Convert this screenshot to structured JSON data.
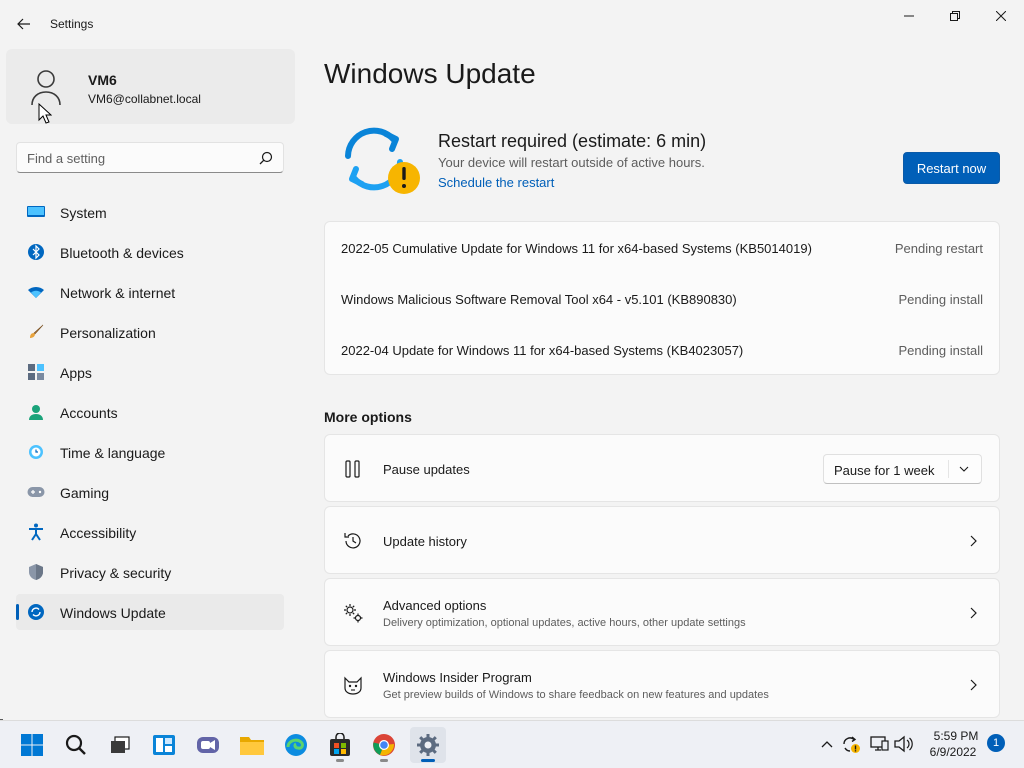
{
  "window": {
    "title": "Settings"
  },
  "profile": {
    "name": "VM6",
    "email": "VM6@collabnet.local"
  },
  "search": {
    "placeholder": "Find a setting"
  },
  "sidebar": {
    "items": [
      {
        "label": "System",
        "icon": "monitor-icon",
        "active": false
      },
      {
        "label": "Bluetooth & devices",
        "icon": "bluetooth-icon",
        "active": false
      },
      {
        "label": "Network & internet",
        "icon": "wifi-icon",
        "active": false
      },
      {
        "label": "Personalization",
        "icon": "brush-icon",
        "active": false
      },
      {
        "label": "Apps",
        "icon": "apps-icon",
        "active": false
      },
      {
        "label": "Accounts",
        "icon": "person-icon",
        "active": false
      },
      {
        "label": "Time & language",
        "icon": "globe-clock-icon",
        "active": false
      },
      {
        "label": "Gaming",
        "icon": "gamepad-icon",
        "active": false
      },
      {
        "label": "Accessibility",
        "icon": "accessibility-icon",
        "active": false
      },
      {
        "label": "Privacy & security",
        "icon": "shield-icon",
        "active": false
      },
      {
        "label": "Windows Update",
        "icon": "update-icon",
        "active": true
      }
    ]
  },
  "main": {
    "title": "Windows Update",
    "status": {
      "title": "Restart required (estimate: 6 min)",
      "subtitle": "Your device will restart outside of active hours.",
      "link": "Schedule the restart",
      "button": "Restart now"
    },
    "updates": [
      {
        "name": "2022-05 Cumulative Update for Windows 11 for x64-based Systems (KB5014019)",
        "status": "Pending restart"
      },
      {
        "name": "Windows Malicious Software Removal Tool x64 - v5.101 (KB890830)",
        "status": "Pending install"
      },
      {
        "name": "2022-04 Update for Windows 11 for x64-based Systems (KB4023057)",
        "status": "Pending install"
      }
    ],
    "more_options": {
      "heading": "More options",
      "pause": {
        "title": "Pause updates",
        "selected": "Pause for 1 week"
      },
      "history": {
        "title": "Update history"
      },
      "advanced": {
        "title": "Advanced options",
        "desc": "Delivery optimization, optional updates, active hours, other update settings"
      },
      "insider": {
        "title": "Windows Insider Program",
        "desc": "Get preview builds of Windows to share feedback on new features and updates"
      }
    }
  },
  "taskbar": {
    "apps": [
      "start-icon",
      "search-icon",
      "task-view-icon",
      "widgets-icon",
      "chat-icon",
      "file-explorer-icon",
      "edge-icon",
      "store-icon",
      "chrome-icon",
      "settings-icon"
    ],
    "clock": {
      "time": "5:59 PM",
      "date": "6/9/2022"
    },
    "notifications": "1"
  },
  "colors": {
    "accent": "#005fb8",
    "warning": "#f7b500"
  }
}
